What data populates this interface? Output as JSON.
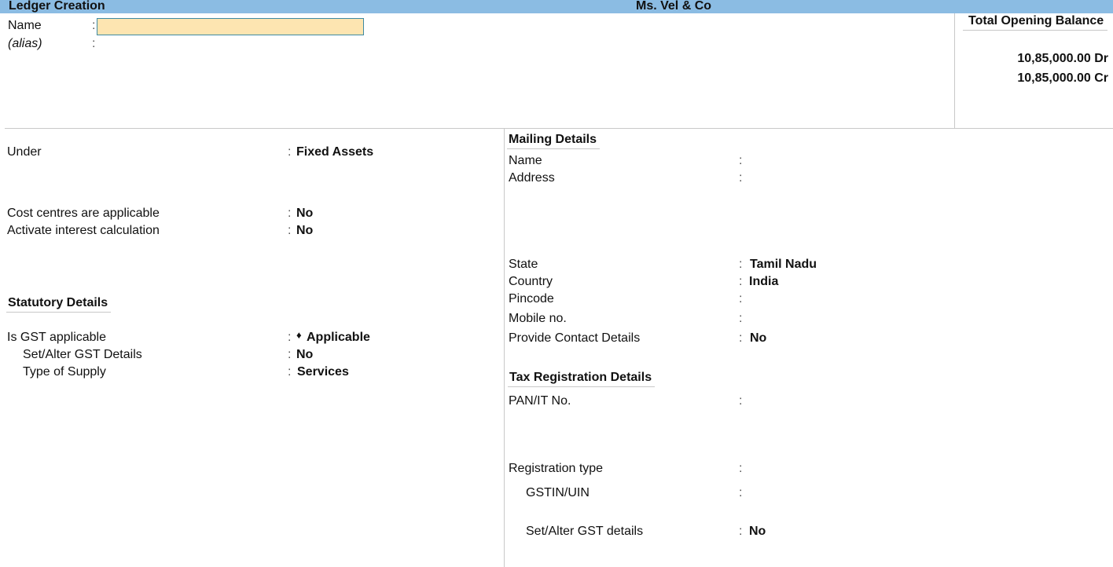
{
  "header": {
    "title": "Ledger Creation",
    "company": "Ms. Vel  & Co"
  },
  "top": {
    "name_label": "Name",
    "name_value": "",
    "alias_label": "(alias)",
    "colon": ":"
  },
  "balance": {
    "title": "Total Opening Balance",
    "debit": "10,85,000.00 Dr",
    "credit": "10,85,000.00 Cr"
  },
  "left": {
    "under": {
      "label": "Under",
      "value": "Fixed Assets"
    },
    "cost_centres": {
      "label": "Cost centres are applicable",
      "value": "No"
    },
    "interest": {
      "label": "Activate interest calculation",
      "value": "No"
    },
    "statutory_title": "Statutory Details",
    "gst_applicable": {
      "label": "Is GST applicable",
      "bullet": "♦",
      "value": "Applicable"
    },
    "set_alter_gst": {
      "label": "Set/Alter GST Details",
      "value": "No"
    },
    "type_of_supply": {
      "label": "Type of Supply",
      "value": "Services"
    }
  },
  "mailing": {
    "title": "Mailing Details",
    "name": {
      "label": "Name",
      "value": ""
    },
    "address": {
      "label": "Address",
      "value": ""
    },
    "state": {
      "label": "State",
      "value": "Tamil Nadu"
    },
    "country": {
      "label": "Country",
      "value": "India"
    },
    "pincode": {
      "label": "Pincode",
      "value": ""
    },
    "mobile": {
      "label": "Mobile no.",
      "value": ""
    },
    "contact": {
      "label": "Provide Contact Details",
      "value": "No"
    }
  },
  "tax": {
    "title": "Tax Registration Details",
    "pan": {
      "label": "PAN/IT No.",
      "value": ""
    },
    "reg_type": {
      "label": "Registration type",
      "value": ""
    },
    "gstin": {
      "label": "GSTIN/UIN",
      "value": ""
    },
    "set_alter": {
      "label": "Set/Alter GST details",
      "value": "No"
    }
  }
}
